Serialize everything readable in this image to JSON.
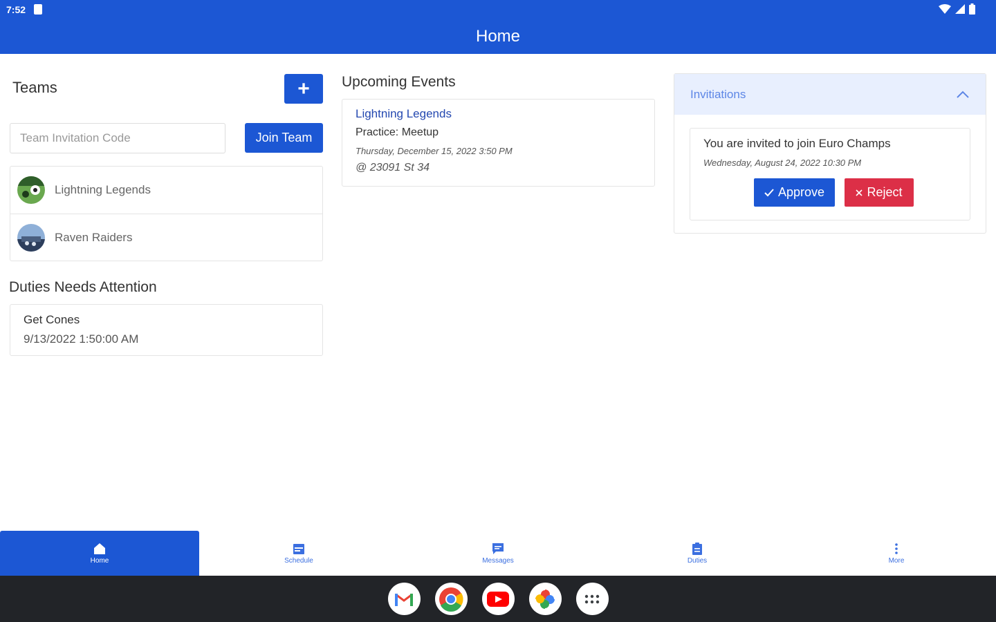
{
  "status_bar": {
    "time": "7:52"
  },
  "app_bar": {
    "title": "Home"
  },
  "teams": {
    "title": "Teams",
    "add_label": "+",
    "code_placeholder": "Team Invitation Code",
    "join_label": "Join Team",
    "items": [
      {
        "name": "Lightning Legends"
      },
      {
        "name": "Raven Raiders"
      }
    ]
  },
  "duties": {
    "title": "Duties Needs Attention",
    "items": [
      {
        "name": "Get Cones",
        "date": "9/13/2022 1:50:00 AM"
      }
    ]
  },
  "events": {
    "title": "Upcoming Events",
    "items": [
      {
        "team": "Lightning Legends",
        "name": "Practice: Meetup",
        "date": "Thursday, December 15, 2022 3:50 PM",
        "location": "@ 23091 St 34"
      }
    ]
  },
  "invitations": {
    "header": "Invitiations",
    "items": [
      {
        "text": "You are invited to join Euro Champs",
        "date": "Wednesday, August 24, 2022 10:30 PM",
        "approve_label": "Approve",
        "reject_label": "Reject"
      }
    ]
  },
  "bottom_nav": {
    "items": [
      {
        "label": "Home",
        "icon": "home-icon"
      },
      {
        "label": "Schedule",
        "icon": "schedule-icon"
      },
      {
        "label": "Messages",
        "icon": "messages-icon"
      },
      {
        "label": "Duties",
        "icon": "clipboard-icon"
      },
      {
        "label": "More",
        "icon": "more-vertical-icon"
      }
    ]
  },
  "dock": {
    "apps": [
      "gmail-icon",
      "chrome-icon",
      "youtube-icon",
      "photos-icon",
      "app-drawer-icon"
    ]
  },
  "colors": {
    "primary": "#1c57d4",
    "danger": "#dc2f47",
    "link": "#2448b0",
    "header_bg": "#e8effe"
  }
}
